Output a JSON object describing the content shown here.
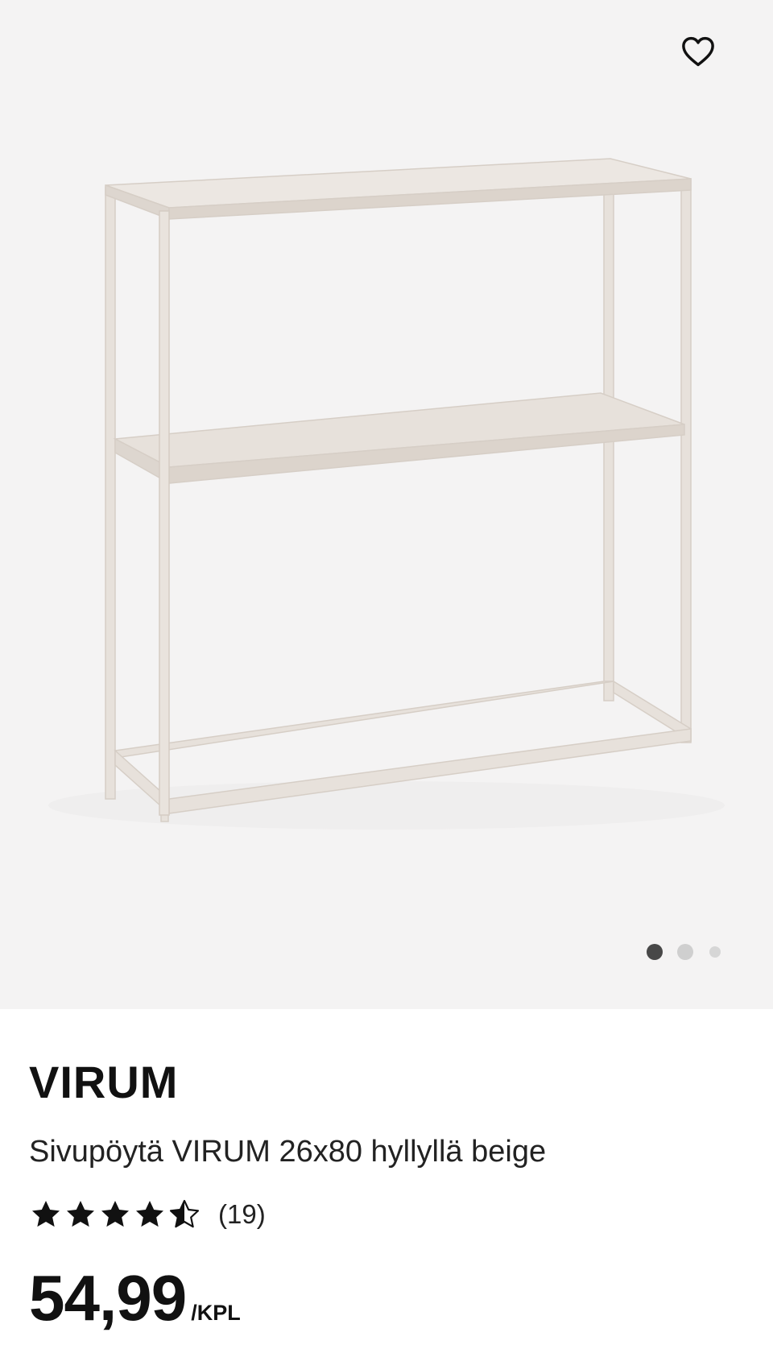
{
  "gallery": {
    "image_alt": "VIRUM side table with shelf, beige",
    "background_color": "#f4f3f3",
    "favorite_icon": "heart-outline-icon",
    "dots": {
      "count": 3,
      "active_index": 0
    }
  },
  "product": {
    "brand": "VIRUM",
    "description": "Sivupöytä VIRUM 26x80 hyllyllä beige",
    "rating": {
      "value": 4.5,
      "max": 5,
      "count_label": "(19)"
    },
    "price": {
      "value": "54,99",
      "unit": "/KPL"
    }
  },
  "colors": {
    "frame_beige": "#e3dcd5",
    "text": "#111111",
    "dot_active": "#484848",
    "dot_inactive": "#cfcfcf"
  }
}
